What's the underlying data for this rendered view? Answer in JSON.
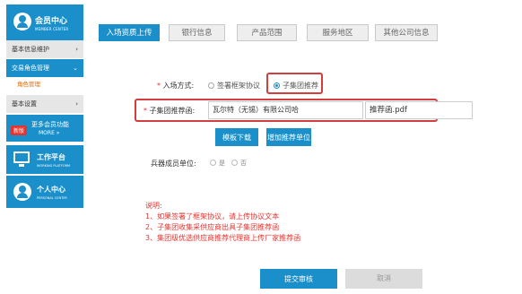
{
  "sidebar": {
    "member_center": {
      "title": "会员中心",
      "subtitle": "MEMBER CENTER"
    },
    "basic_info": "基本信息维护",
    "trade_role": "交易角色管理",
    "role_manage": "角色管理",
    "settings": "基本设置",
    "more_functions": {
      "badge": "新版",
      "title": "更多会员功能",
      "more": "MORE »"
    },
    "workbench": {
      "title": "工作平台",
      "subtitle": "WORKING PLATFORM"
    },
    "personal": {
      "title": "个人中心",
      "subtitle": "PERSONAL CENTER"
    }
  },
  "tabs": [
    "入场资质上传",
    "银行信息",
    "产品范围",
    "服务地区",
    "其他公司信息"
  ],
  "form": {
    "entry_method_label": "入场方式:",
    "entry_options": [
      "签署框架协议",
      "子集团推荐"
    ],
    "entry_selected": "子集团推荐",
    "letter_label": "子集团推荐函:",
    "company_value": "瓦尔特（无锡）有限公司哈",
    "file_value": "推荐函.pdf",
    "template_button": "模板下载",
    "add_unit_button": "增加推荐单位",
    "weapon_label": "兵器成员单位:",
    "weapon_options": [
      "是",
      "否"
    ]
  },
  "notes": {
    "title": "说明:",
    "lines": [
      "1、如果签署了框架协议，请上传协议文本",
      "2、子集团收集采供应商出具子集团推荐函",
      "3、集团级优选供应商推荐代理商上传厂家推荐函"
    ]
  },
  "actions": {
    "submit": "提交审核",
    "cancel": "取消"
  },
  "colors": {
    "primary": "#1a8fc9",
    "highlight": "#d43d3d",
    "note": "#e3342f"
  }
}
